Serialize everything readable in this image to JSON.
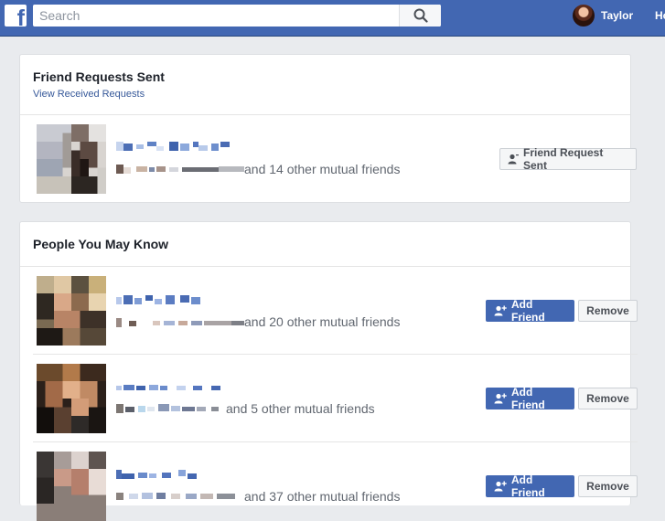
{
  "header": {
    "search_placeholder": "Search",
    "profile_name": "Taylor",
    "home_label": "Home"
  },
  "requests_sent": {
    "title": "Friend Requests Sent",
    "view_received_link": "View Received Requests",
    "items": [
      {
        "mutual_text": "and 14 other mutual friends",
        "button_label": "Friend Request Sent"
      }
    ]
  },
  "people_you_may_know": {
    "title": "People You May Know",
    "add_label": "Add Friend",
    "remove_label": "Remove",
    "items": [
      {
        "mutual_text": "and 20 other mutual friends"
      },
      {
        "mutual_text": "and 5 other mutual friends"
      },
      {
        "mutual_text": "and 37 other mutual friends"
      }
    ]
  },
  "colors": {
    "brand_blue": "#4267b2",
    "link_blue": "#365899",
    "page_bg": "#e9ebee"
  },
  "icons": [
    "facebook-logo-icon",
    "search-icon",
    "user-icon",
    "add-friend-icon"
  ]
}
